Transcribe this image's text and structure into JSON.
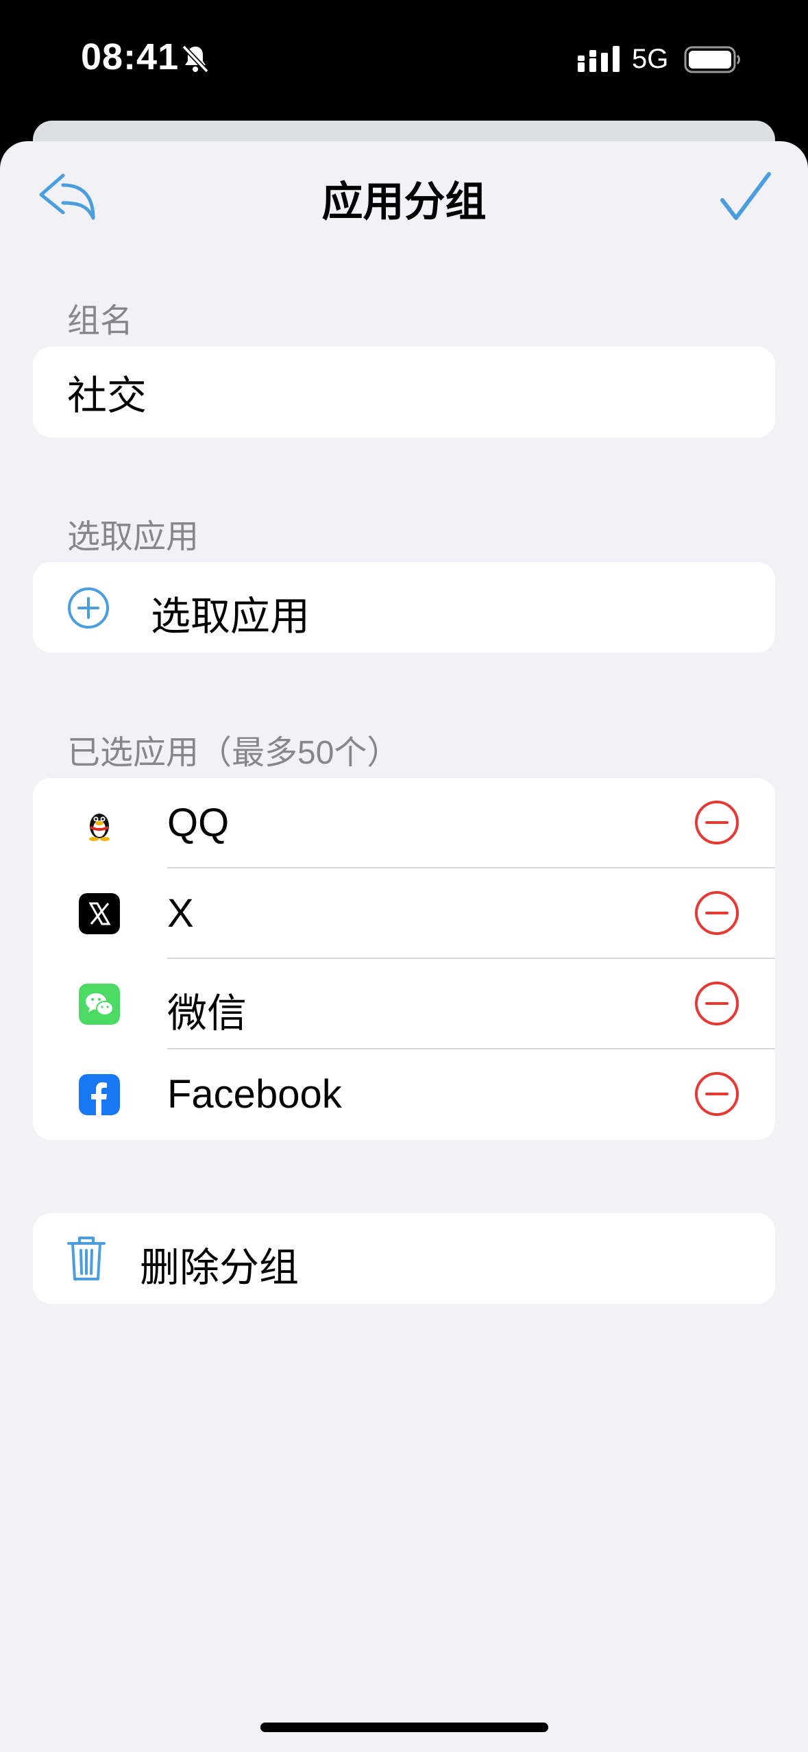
{
  "status_bar": {
    "time": "08:41",
    "network": "5G",
    "silent": true,
    "battery_level": 1.0
  },
  "nav": {
    "title": "应用分组",
    "back_icon": "reply-arrow-icon",
    "confirm_icon": "checkmark-icon"
  },
  "group_name": {
    "label": "组名",
    "value": "社交"
  },
  "pick_apps": {
    "label": "选取应用",
    "button_label": "选取应用",
    "icon": "plus-circle-icon"
  },
  "selected_apps": {
    "label": "已选应用（最多50个）",
    "items": [
      {
        "name": "QQ",
        "icon": "qq-penguin-icon"
      },
      {
        "name": "X",
        "icon": "x-logo-icon"
      },
      {
        "name": "微信",
        "icon": "wechat-icon"
      },
      {
        "name": "Facebook",
        "icon": "facebook-icon"
      }
    ]
  },
  "delete_group": {
    "label": "删除分组",
    "icon": "trash-icon"
  },
  "colors": {
    "accent": "#4a9ede",
    "destructive": "#e53935",
    "background": "#f1f1f6",
    "secondary_text": "#86868b"
  }
}
